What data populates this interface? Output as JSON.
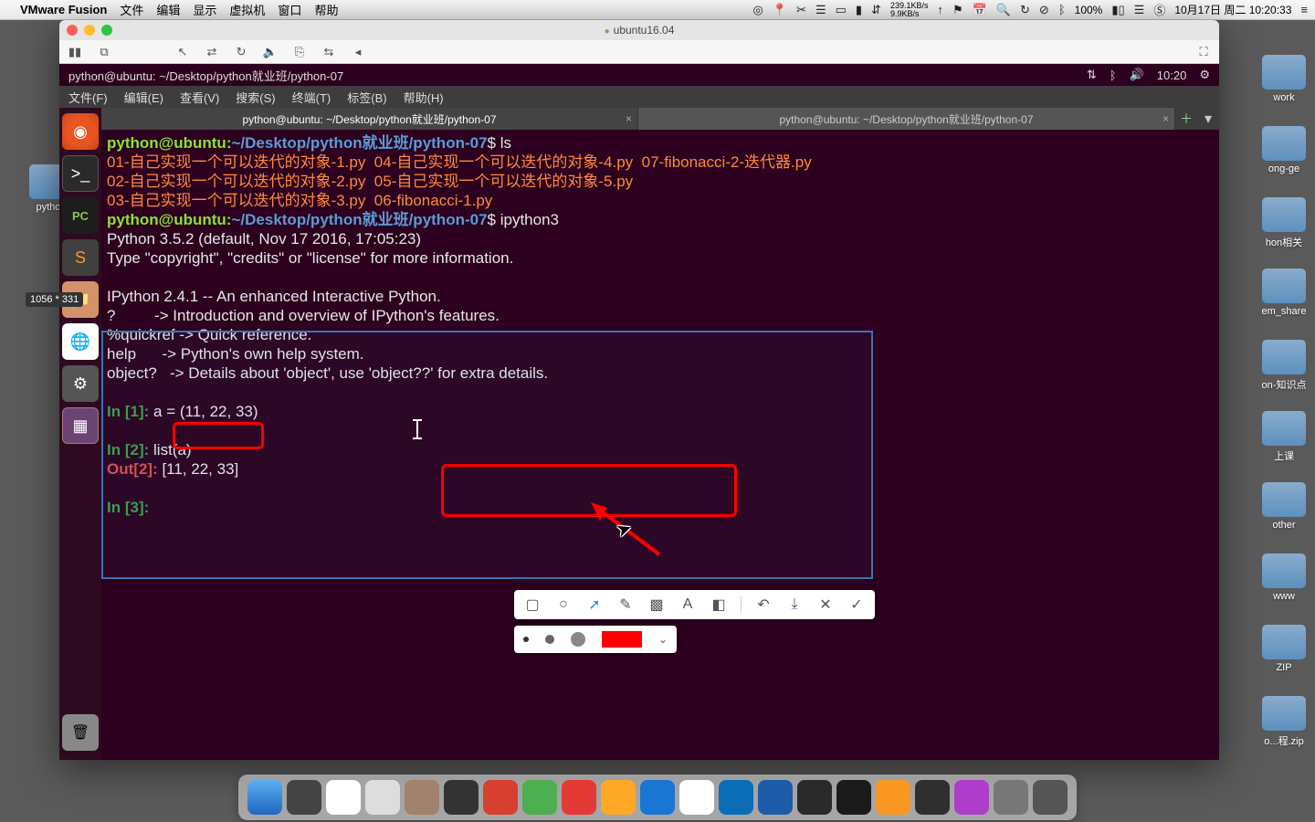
{
  "mac_menubar": {
    "app_name": "VMware Fusion",
    "menus": [
      "文件",
      "编辑",
      "显示",
      "虚拟机",
      "窗口",
      "帮助"
    ],
    "right": {
      "net": "239.1KB/s\n9.9KB/s",
      "battery": "100%",
      "date": "10月17日 周二 10:20:33"
    }
  },
  "vm_window": {
    "title": "ubuntu16.04"
  },
  "ubuntu_topbar": {
    "title": "python@ubuntu: ~/Desktop/python就业班/python-07",
    "time": "10:20"
  },
  "gnome_menu": [
    "文件(F)",
    "编辑(E)",
    "查看(V)",
    "搜索(S)",
    "终端(T)",
    "标签(B)",
    "帮助(H)"
  ],
  "tabs": [
    {
      "label": "python@ubuntu: ~/Desktop/python就业班/python-07",
      "active": true
    },
    {
      "label": "python@ubuntu: ~/Desktop/python就业班/python-07",
      "active": false
    }
  ],
  "pixel_tip": "1056 * 331",
  "terminal": {
    "user": "python@ubuntu",
    "path": "~/Desktop/python就业班/python-07",
    "cmd1": "ls",
    "ls_line1": "01-自己实现一个可以迭代的对象-1.py  04-自己实现一个可以迭代的对象-4.py  07-fibonacci-2-迭代器.py",
    "ls_line2": "02-自己实现一个可以迭代的对象-2.py  05-自己实现一个可以迭代的对象-5.py",
    "ls_line3": "03-自己实现一个可以迭代的对象-3.py  06-fibonacci-1.py",
    "cmd2": "ipython3",
    "py_ver": "Python 3.5.2 (default, Nov 17 2016, 17:05:23)",
    "py_info": "Type \"copyright\", \"credits\" or \"license\" for more information.",
    "ipy_ver": "IPython 2.4.1 -- An enhanced Interactive Python.",
    "ipy_intro": "?         -> Introduction and overview of IPython's features.",
    "ipy_quick": "%quickref -> Quick reference.",
    "ipy_help": "help      -> Python's own help system.",
    "ipy_obj": "object?   -> Details about 'object', use 'object??' for extra details.",
    "in1_prefix": "In [",
    "in1_n": "1",
    "in1_suffix": "]: ",
    "in1_code": "a = (11, 22, 33)",
    "in2_n": "2",
    "in2_code": "list(a)",
    "out2_prefix": "Out[",
    "out2_n": "2",
    "out2_suffix": "]: ",
    "out2_val": "[11, 22, 33]",
    "in3_n": "3"
  },
  "desktop_labels": [
    "work",
    "ong-ge",
    "hon相关",
    "em_share",
    "on-知识点",
    "上课",
    "other",
    "www",
    "ZIP",
    "o...程.zip"
  ],
  "left_desktop_label": "python"
}
